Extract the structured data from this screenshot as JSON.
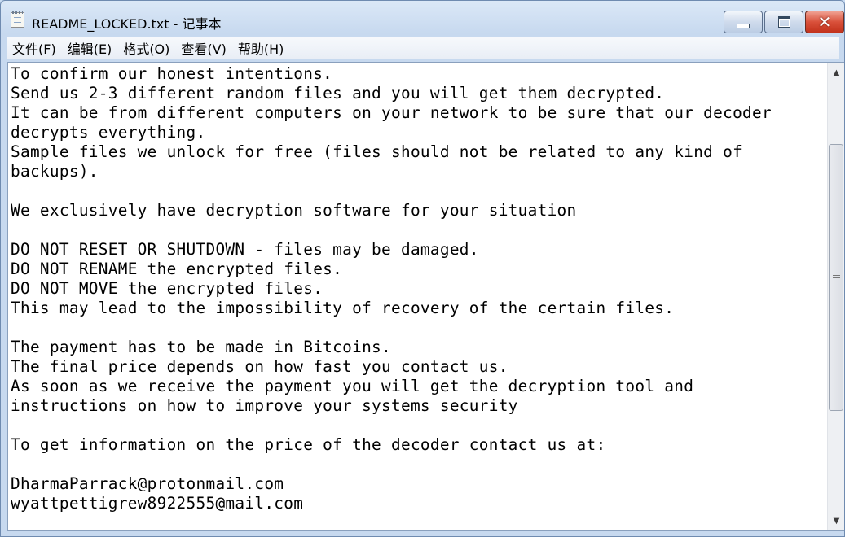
{
  "window": {
    "title": "README_LOCKED.txt - 记事本",
    "app_icon": "notepad-icon",
    "controls": {
      "minimize_icon": "minimize-icon",
      "maximize_icon": "maximize-icon",
      "close_icon": "close-icon",
      "close_glyph": "✕"
    }
  },
  "menu": [
    {
      "label": "文件(F)"
    },
    {
      "label": "编辑(E)"
    },
    {
      "label": "格式(O)"
    },
    {
      "label": "查看(V)"
    },
    {
      "label": "帮助(H)"
    }
  ],
  "document": {
    "lines": [
      "To confirm our honest intentions.",
      "Send us 2-3 different random files and you will get them decrypted.",
      "It can be from different computers on your network to be sure that our decoder",
      "decrypts everything.",
      "Sample files we unlock for free (files should not be related to any kind of",
      "backups).",
      "",
      "We exclusively have decryption software for your situation",
      "",
      "DO NOT RESET OR SHUTDOWN - files may be damaged.",
      "DO NOT RENAME the encrypted files.",
      "DO NOT MOVE the encrypted files.",
      "This may lead to the impossibility of recovery of the certain files.",
      "",
      "The payment has to be made in Bitcoins.",
      "The final price depends on how fast you contact us.",
      "As soon as we receive the payment you will get the decryption tool and",
      "instructions on how to improve your systems security",
      "",
      "To get information on the price of the decoder contact us at:",
      "",
      "DharmaParrack@protonmail.com",
      "wyattpettigrew8922555@mail.com"
    ]
  },
  "scrollbar": {
    "up_glyph": "▲",
    "down_glyph": "▼",
    "position_fraction": 0.38
  },
  "colors": {
    "titlebar": "#dbe8f7",
    "close_button": "#d9503a",
    "text": "#000000",
    "editor_background": "#ffffff"
  }
}
